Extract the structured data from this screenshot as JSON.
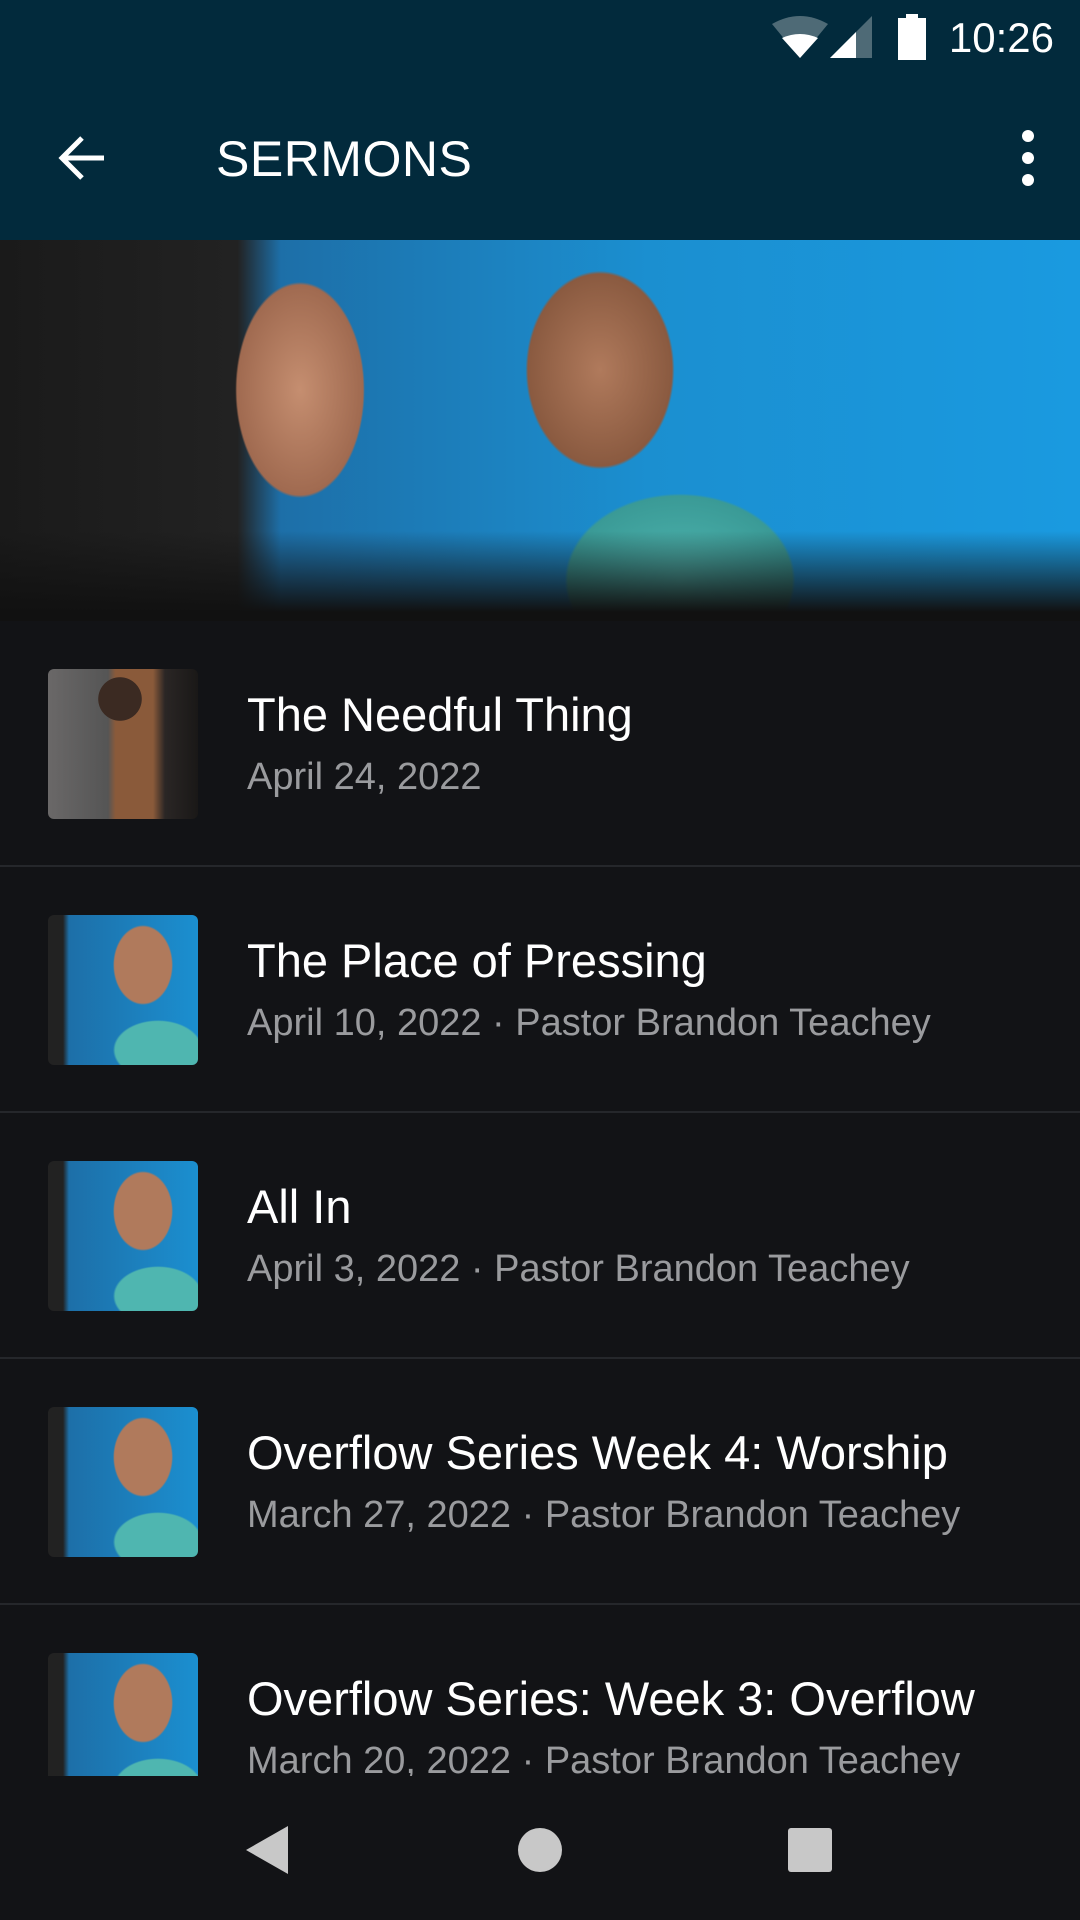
{
  "status_bar": {
    "time": "10:26",
    "icons": [
      "wifi-icon",
      "signal-icon",
      "battery-icon"
    ]
  },
  "app_bar": {
    "title": "SERMONS",
    "back_icon": "arrow-left-icon",
    "menu_icon": "more-vert-icon"
  },
  "colors": {
    "app_bar": "#022a3c",
    "background": "#121316",
    "subtitle": "#9a9b9e"
  },
  "sermons": [
    {
      "title": "The Needful Thing",
      "subtitle": "April 24, 2022"
    },
    {
      "title": "The Place of Pressing",
      "subtitle": "April 10, 2022 · Pastor Brandon Teachey"
    },
    {
      "title": "All In",
      "subtitle": "April 3, 2022 · Pastor Brandon Teachey"
    },
    {
      "title": "Overflow Series Week 4: Worship",
      "subtitle": "March 27, 2022 · Pastor Brandon Teachey"
    },
    {
      "title": "Overflow Series: Week 3: Overflow",
      "subtitle": "March 20, 2022 · Pastor Brandon Teachey"
    }
  ],
  "nav_bar": {
    "icons": [
      "back-triangle-icon",
      "home-circle-icon",
      "recents-square-icon"
    ]
  }
}
